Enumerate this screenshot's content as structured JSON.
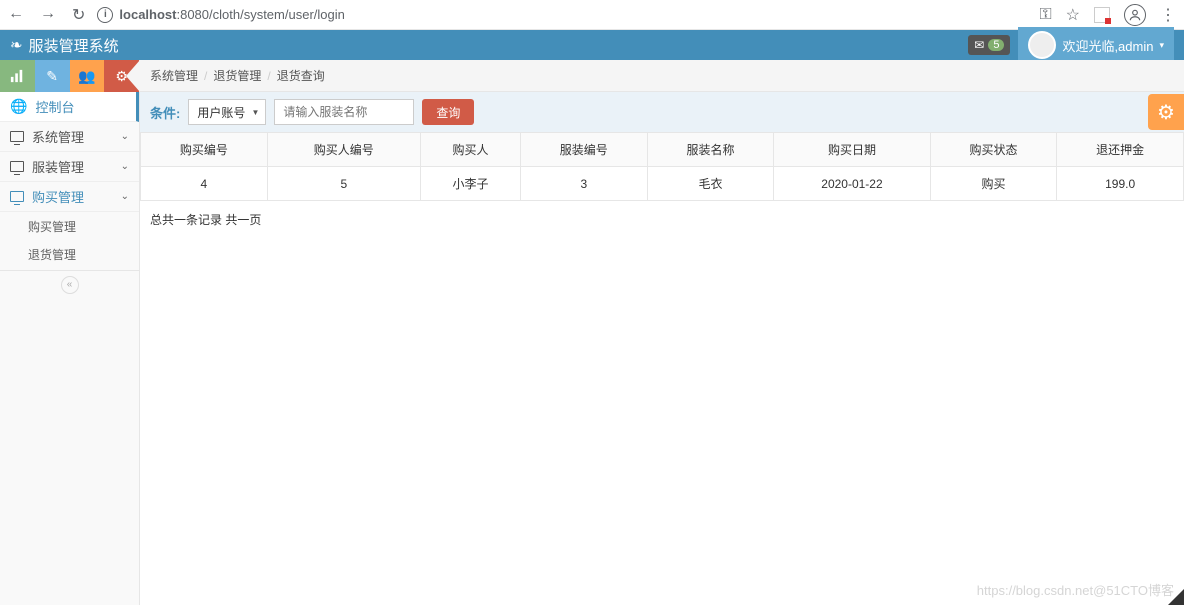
{
  "browser": {
    "url_host": "localhost",
    "url_path": ":8080/cloth/system/user/login"
  },
  "header": {
    "app_title": "服装管理系统",
    "badge_count": "5",
    "welcome_text": "欢迎光临,admin"
  },
  "sidebar": {
    "console": "控制台",
    "items": [
      {
        "label": "系统管理"
      },
      {
        "label": "服装管理"
      },
      {
        "label": "购买管理"
      }
    ],
    "subitems": [
      {
        "label": "购买管理"
      },
      {
        "label": "退货管理"
      }
    ]
  },
  "breadcrumb": {
    "lv1": "系统管理",
    "lv2": "退货管理",
    "lv3": "退货查询"
  },
  "filter": {
    "label": "条件:",
    "select_value": "用户账号",
    "placeholder": "请输入服装名称",
    "search_btn": "查询"
  },
  "table": {
    "headers": [
      "购买编号",
      "购买人编号",
      "购买人",
      "服装编号",
      "服装名称",
      "购买日期",
      "购买状态",
      "退还押金"
    ],
    "rows": [
      {
        "c0": "4",
        "c1": "5",
        "c2": "小李子",
        "c3": "3",
        "c4": "毛衣",
        "c5": "2020-01-22",
        "c6": "购买",
        "c7": "199.0"
      }
    ]
  },
  "pagination": "总共一条记录 共一页",
  "watermark": "https://blog.csdn.net@51CTO博客"
}
